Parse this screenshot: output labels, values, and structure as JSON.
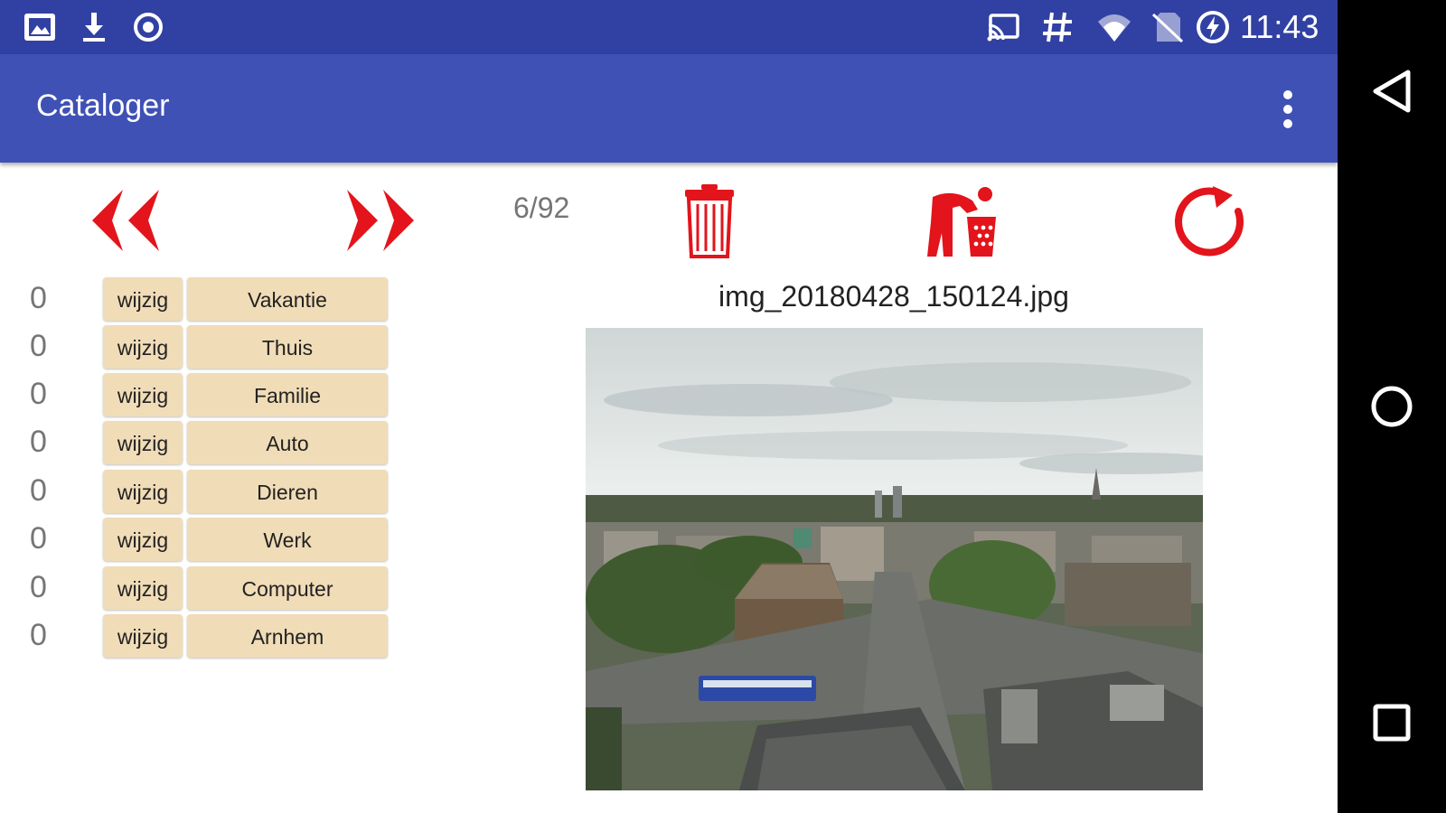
{
  "status_bar": {
    "time": "11:43",
    "icons": [
      "photo-notification-icon",
      "download-icon",
      "record-icon",
      "cast-icon",
      "hash-icon",
      "wifi-icon",
      "no-sim-icon",
      "battery-charging-icon"
    ]
  },
  "app_bar": {
    "title": "Cataloger",
    "overflow_icon": "more-vert-icon"
  },
  "toolbar": {
    "prev_icon": "double-chevron-left-icon",
    "next_icon": "double-chevron-right-icon",
    "counter": "6/92",
    "delete_icon": "trash-icon",
    "dispose_icon": "person-trash-icon",
    "rotate_icon": "rotate-icon",
    "accent_color": "#e3141b"
  },
  "categories": [
    {
      "count": "0",
      "edit_label": "wijzig",
      "name": "Vakantie"
    },
    {
      "count": "0",
      "edit_label": "wijzig",
      "name": "Thuis"
    },
    {
      "count": "0",
      "edit_label": "wijzig",
      "name": "Familie"
    },
    {
      "count": "0",
      "edit_label": "wijzig",
      "name": "Auto"
    },
    {
      "count": "0",
      "edit_label": "wijzig",
      "name": "Dieren"
    },
    {
      "count": "0",
      "edit_label": "wijzig",
      "name": "Werk"
    },
    {
      "count": "0",
      "edit_label": "wijzig",
      "name": "Computer"
    },
    {
      "count": "0",
      "edit_label": "wijzig",
      "name": "Arnhem"
    }
  ],
  "image": {
    "filename": "img_20180428_150124.jpg"
  },
  "colors": {
    "status_bar": "#3141a3",
    "app_bar": "#3f51b5",
    "button_bg": "#f0dcb7",
    "accent": "#e3141b"
  }
}
